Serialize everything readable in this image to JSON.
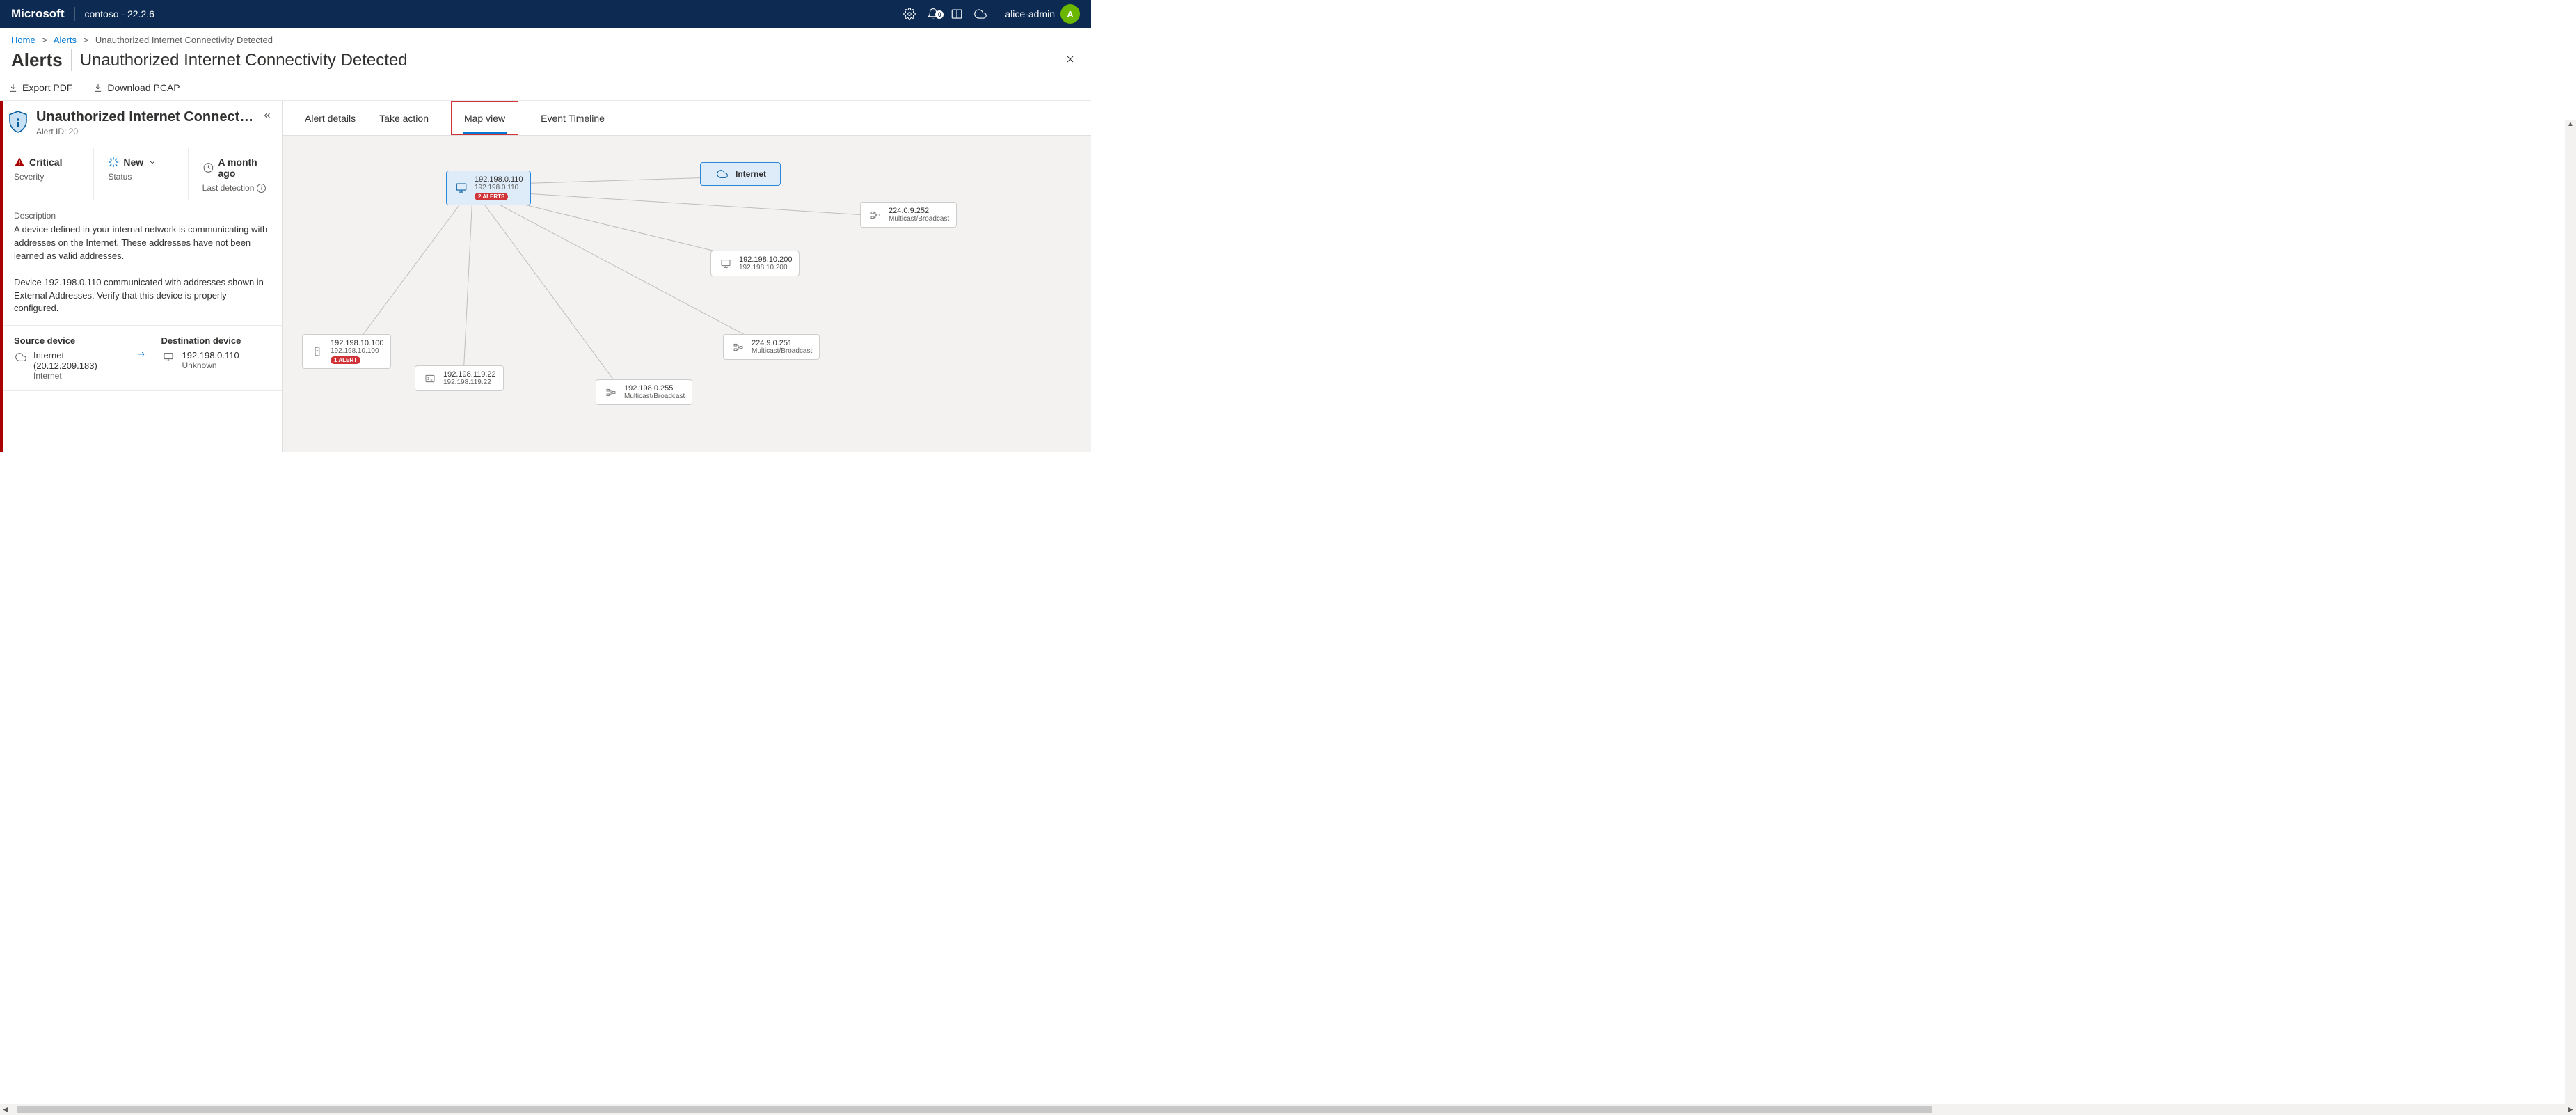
{
  "topbar": {
    "brand": "Microsoft",
    "tenant": "contoso - 22.2.6",
    "badge_count": "0",
    "username": "alice-admin",
    "avatar_initial": "A"
  },
  "breadcrumb": {
    "home": "Home",
    "alerts": "Alerts",
    "current": "Unauthorized Internet Connectivity Detected"
  },
  "page": {
    "section_title": "Alerts",
    "subtitle": "Unauthorized Internet Connectivity Detected"
  },
  "commands": {
    "export_pdf": "Export PDF",
    "download_pcap": "Download PCAP"
  },
  "left_panel": {
    "title": "Unauthorized Internet Connect…",
    "alert_id_label": "Alert ID: 20",
    "metrics": {
      "severity_value": "Critical",
      "severity_label": "Severity",
      "status_value": "New",
      "status_label": "Status",
      "detection_value": "A month ago",
      "detection_label": "Last detection"
    },
    "description_label": "Description",
    "description_p1": "A device defined in your internal network is communicating with addresses on the Internet. These addresses have not been learned as valid addresses.",
    "description_p2": "Device 192.198.0.110 communicated with addresses shown in External Addresses. Verify that this device is properly configured.",
    "source_label": "Source device",
    "destination_label": "Destination device",
    "source": {
      "name": "Internet (20.12.209.183)",
      "type": "Internet"
    },
    "destination": {
      "name": "192.198.0.110",
      "type": "Unknown"
    }
  },
  "tabs": {
    "details": "Alert details",
    "action": "Take action",
    "map": "Map view",
    "timeline": "Event Timeline"
  },
  "map": {
    "internet_label": "Internet",
    "nodes": {
      "primary": {
        "line1": "192.198.0.110",
        "line2": "192.198.0.110",
        "badge": "2 ALERTS"
      },
      "n1": {
        "line1": "192.198.10.100",
        "line2": "192.198.10.100",
        "badge": "1 ALERT"
      },
      "n2": {
        "line1": "192.198.119.22",
        "line2": "192.198.119.22"
      },
      "n3": {
        "line1": "192.198.0.255",
        "line2": "Multicast/Broadcast"
      },
      "n4": {
        "line1": "224.9.0.251",
        "line2": "Multicast/Broadcast"
      },
      "n5": {
        "line1": "192.198.10.200",
        "line2": "192.198.10.200"
      },
      "n6": {
        "line1": "224.0.9.252",
        "line2": "Multicast/Broadcast"
      }
    }
  }
}
